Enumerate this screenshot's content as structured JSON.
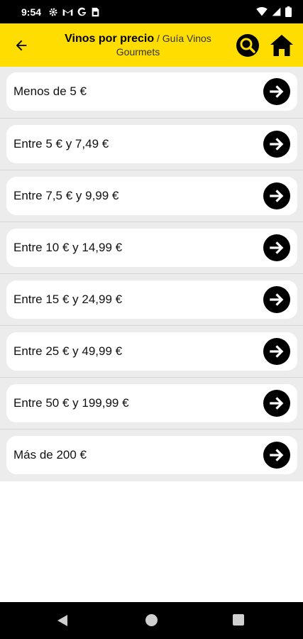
{
  "status_bar": {
    "time": "9:54",
    "left_icons": [
      "gear-icon",
      "gmail-icon",
      "google-icon",
      "sim-icon"
    ],
    "right_icons": [
      "wifi-icon",
      "signal-icon",
      "battery-icon"
    ]
  },
  "app_bar": {
    "title": "Vinos por precio",
    "separator": " / ",
    "subtitle_line1": "Guía Vinos",
    "subtitle_line2": "Gourmets",
    "back_icon": "back-arrow-icon",
    "search_icon": "search-icon",
    "home_icon": "home-icon",
    "color": "#ffdd00"
  },
  "price_ranges": [
    {
      "label": "Menos de 5 €"
    },
    {
      "label": "Entre 5 € y 7,49 €"
    },
    {
      "label": "Entre 7,5 € y 9,99 €"
    },
    {
      "label": "Entre 10 € y 14,99 €"
    },
    {
      "label": "Entre 15 € y 24,99 €"
    },
    {
      "label": "Entre 25 € y 49,99 €"
    },
    {
      "label": "Entre 50 € y 199,99 €"
    },
    {
      "label": "Más de 200 €"
    }
  ],
  "nav_bar": {
    "buttons": [
      "nav-back-icon",
      "nav-home-icon",
      "nav-recents-icon"
    ]
  }
}
